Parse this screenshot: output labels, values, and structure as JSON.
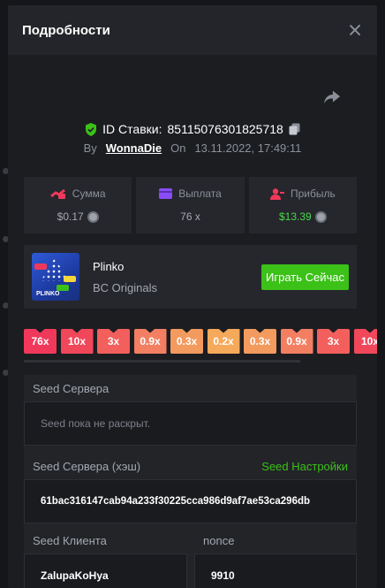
{
  "modal": {
    "title": "Подробности"
  },
  "bet": {
    "id_label": "ID Ставки:",
    "id_value": "85115076301825718",
    "by_label": "By",
    "username": "WonnaDie",
    "on_label": "On",
    "datetime": "13.11.2022, 17:49:11"
  },
  "stats": {
    "amount": {
      "label": "Сумма",
      "value": "$0.17"
    },
    "payout": {
      "label": "Выплата",
      "value": "76 x"
    },
    "profit": {
      "label": "Прибыль",
      "value": "$13.39"
    }
  },
  "game": {
    "name": "Plinko",
    "provider": "BC Originals",
    "play_label": "Играть Сейчас",
    "thumb_label": "PLINKO"
  },
  "multipliers": [
    {
      "label": "76x",
      "color": "#f0395a"
    },
    {
      "label": "10x",
      "color": "#f0475a"
    },
    {
      "label": "3x",
      "color": "#f25f5c"
    },
    {
      "label": "0.9x",
      "color": "#f37f62"
    },
    {
      "label": "0.3x",
      "color": "#f39a5e"
    },
    {
      "label": "0.2x",
      "color": "#f5a95a"
    },
    {
      "label": "0.3x",
      "color": "#f39a5e"
    },
    {
      "label": "0.9x",
      "color": "#f37f62"
    },
    {
      "label": "3x",
      "color": "#f25f5c"
    },
    {
      "label": "10x",
      "color": "#f0475a"
    }
  ],
  "seeds": {
    "server_label": "Seed Сервера",
    "server_placeholder": "Seed пока не раскрыт.",
    "server_hash_label": "Seed Сервера (хэш)",
    "settings_link": "Seed Настройки",
    "server_hash_value": "61bac316147cab94a233f30225cca986d9af7ae53ca296db",
    "client_label": "Seed Клиента",
    "client_value": "ZalupaKoHya",
    "nonce_label": "nonce",
    "nonce_value": "9910"
  },
  "colors": {
    "accent_green": "#3bc117",
    "profit_green": "#4bd84b",
    "bg": "#1c1d21"
  }
}
